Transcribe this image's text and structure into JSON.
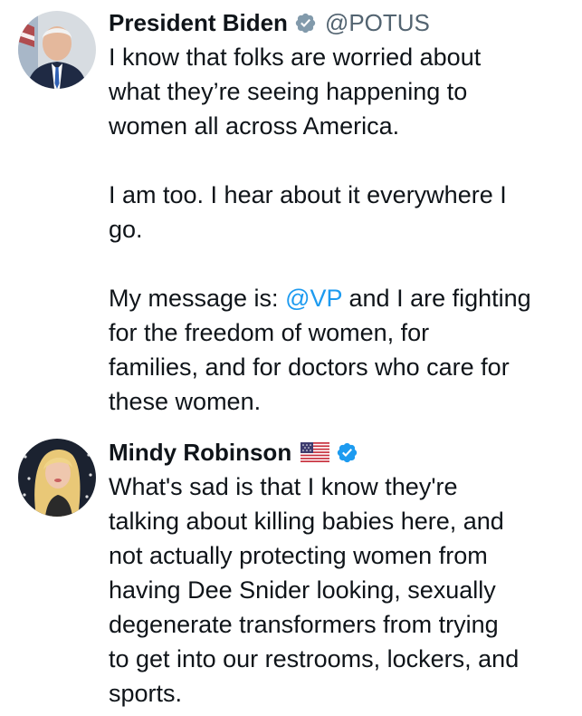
{
  "tweets": [
    {
      "author_name": "President Biden",
      "verified_badge": "gray-verified-badge-icon",
      "handle": "@POTUS",
      "paragraphs": [
        {
          "lines": [
            "I know that folks are worried about",
            "what they’re seeing happening to",
            "women all across America."
          ]
        },
        {
          "lines": [
            "I am too. I hear about it everywhere I",
            "go."
          ]
        },
        {
          "line1_prefix": "My message is: ",
          "line1_mention": "@VP",
          "line1_suffix": " and I are fighting",
          "rest_lines": [
            "for the freedom of women, for",
            "families, and for doctors who care for",
            "these women."
          ]
        }
      ]
    },
    {
      "author_name": "Mindy Robinson",
      "flag_icon": "us-flag-icon",
      "verified_badge": "blue-verified-badge-icon",
      "lines": [
        "What's sad is that I know they're",
        "talking about killing babies here, and",
        "not actually protecting women from",
        "having Dee Snider looking, sexually",
        "degenerate transformers from trying",
        "to get into our restrooms, lockers, and",
        "sports."
      ]
    }
  ],
  "colors": {
    "text": "#0f1419",
    "secondary_text": "#536471",
    "link": "#1d9bf0",
    "gray_badge": "#829aab",
    "blue_badge": "#1d9bf0"
  }
}
